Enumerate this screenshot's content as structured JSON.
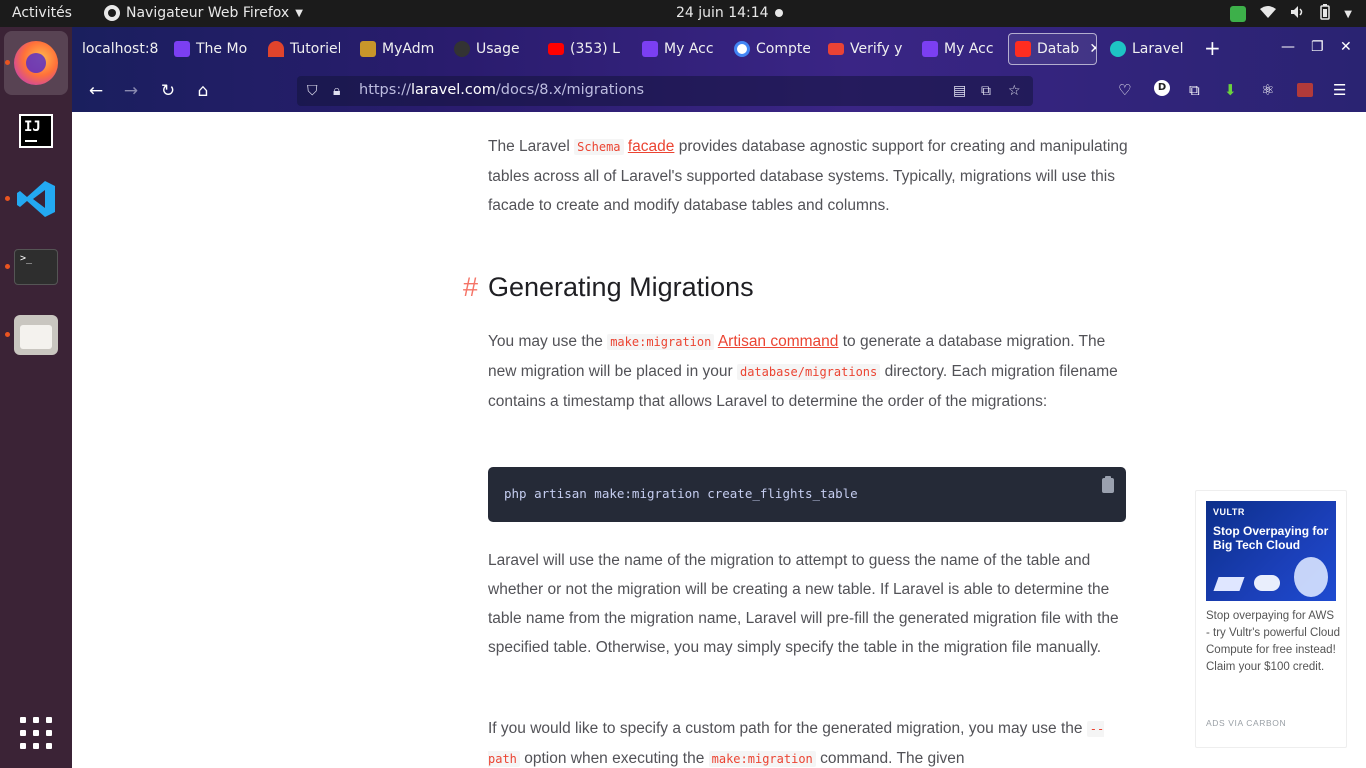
{
  "topbar": {
    "activities": "Activités",
    "app_menu": "Navigateur Web Firefox",
    "clock": "24 juin  14:14"
  },
  "dock": {
    "ij_label": "IJ",
    "terminal_prompt": ">_"
  },
  "tabs": [
    {
      "label": "localhost:8",
      "favicon_color": "#2a2a2a"
    },
    {
      "label": "The Mo",
      "favicon_color": "#7b3ff2"
    },
    {
      "label": "Tutoriel",
      "favicon_color": "#e0442c"
    },
    {
      "label": "MyAdm",
      "favicon_color": "#c8962a"
    },
    {
      "label": "Usage",
      "favicon_color": "#333333"
    },
    {
      "label": "(353) L",
      "favicon_color": "#ff0000"
    },
    {
      "label": "My Acc",
      "favicon_color": "#7b3ff2"
    },
    {
      "label": "Compte",
      "favicon_color": "#4285f4"
    },
    {
      "label": "Verify y",
      "favicon_color": "#ea4335"
    },
    {
      "label": "My Acc",
      "favicon_color": "#7b3ff2"
    },
    {
      "label": "Datab",
      "favicon_color": "#ff2d20"
    },
    {
      "label": "Laravel",
      "favicon_color": "#1ec4c4"
    }
  ],
  "url": {
    "scheme": "https://",
    "host": "laravel.com",
    "path": "/docs/8.x/migrations"
  },
  "content": {
    "intro": {
      "t1": "The Laravel ",
      "code1": "Schema",
      "link1": "facade",
      "t2": " provides database agnostic support for creating and manipulating tables across all of Laravel's supported database systems. Typically, migrations will use this facade to create and modify database tables and columns."
    },
    "heading_hash": "#",
    "heading": "Generating Migrations",
    "p1": {
      "t1": "You may use the ",
      "code1": "make:migration",
      "link1": "Artisan command",
      "t2": " to generate a database migration. The new migration will be placed in your ",
      "code2": "database/migrations",
      "t3": " directory. Each migration filename contains a timestamp that allows Laravel to determine the order of the migrations:"
    },
    "code_block": "php artisan make:migration create_flights_table",
    "p2": "Laravel will use the name of the migration to attempt to guess the name of the table and whether or not the migration will be creating a new table. If Laravel is able to determine the table name from the migration name, Laravel will pre-fill the generated migration file with the specified table. Otherwise, you may simply specify the table in the migration file manually.",
    "p3": {
      "t1": "If you would like to specify a custom path for the generated migration, you may use the ",
      "code1": "--path",
      "t2": " option when executing the ",
      "code2": "make:migration",
      "t3": " command. The given"
    }
  },
  "ad": {
    "brand": "VULTR",
    "headline": "Stop Overpaying for Big Tech Cloud",
    "body": "Stop overpaying for AWS - try Vultr's powerful Cloud Compute for free instead! Claim your $100 credit.",
    "via": "ADS VIA CARBON"
  },
  "colors": {
    "accent": "#eb4432",
    "code_bg": "#252a37",
    "dock_bg": "#3b2336"
  }
}
